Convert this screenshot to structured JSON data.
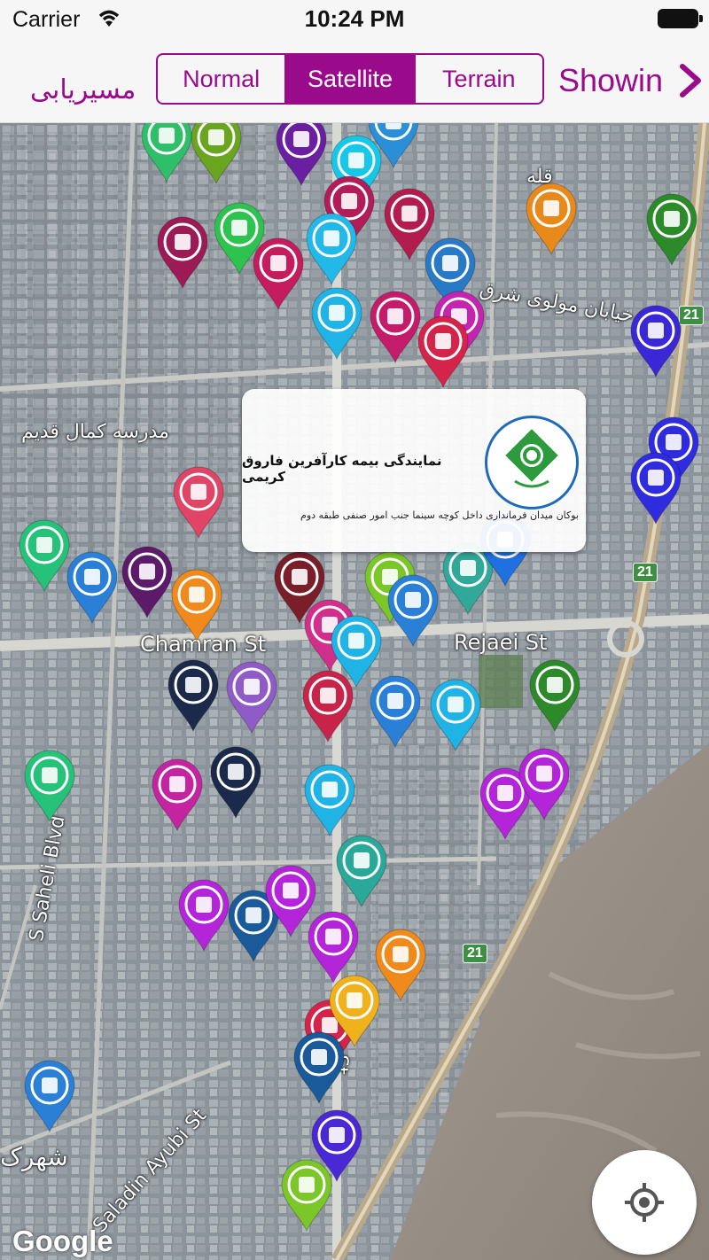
{
  "status_bar": {
    "carrier": "Carrier",
    "time": "10:24 PM"
  },
  "nav_bar": {
    "left_label": "مسیریابی",
    "map_types": [
      "Normal",
      "Satellite",
      "Terrain"
    ],
    "selected_map_type": "Satellite",
    "right_label": "Showin",
    "accent_color": "#9a0b8c"
  },
  "map": {
    "labels": {
      "qaleh": "قله",
      "molavi_street": "خیابان مولوی شرق",
      "kamal_school": "مدرسه کمال قدیم",
      "chamran": "Chamran St",
      "rejaei": "Rejaei St",
      "saheli": "S Saheli Blvd",
      "ayubi": "Saladin Ayubi St",
      "shahrak": "شهرک",
      "st": "St"
    },
    "road_shields": [
      "21",
      "21",
      "21"
    ],
    "callout": {
      "title": "نمایندگی بیمه کارآفرین فاروق کریمی",
      "address": "بوکان میدان فرمانداری داخل کوچه سینما جنب امور صنفی طبقه دوم"
    },
    "attribution": "Google"
  }
}
